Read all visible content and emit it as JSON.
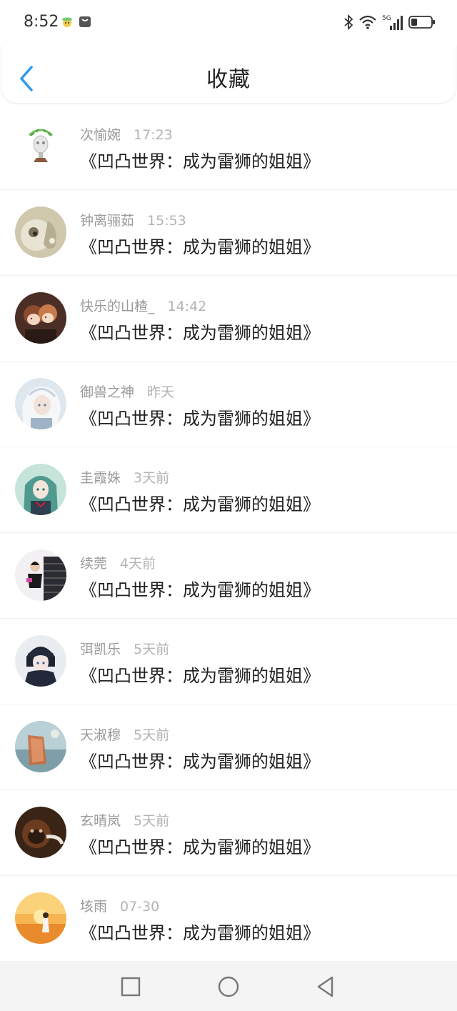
{
  "status_bar": {
    "time": "8:52",
    "icons": [
      "notification-face-icon",
      "notification-app-icon",
      "bluetooth-icon",
      "wifi-icon",
      "cellular-5g-icon",
      "battery-icon"
    ],
    "network_label": "5G",
    "battery_level": 0.3
  },
  "header": {
    "title": "收藏",
    "back_icon": "chevron-left-icon",
    "accent_color": "#2f9bf0"
  },
  "items": [
    {
      "name": "次愉婉",
      "time": "17:23",
      "message": "《凹凸世界：成为雷狮的姐姐》",
      "avatar": "trophy-figure"
    },
    {
      "name": "钟离骊茹",
      "time": "15:53",
      "message": "《凹凸世界：成为雷狮的姐姐》",
      "avatar": "animal-closeup"
    },
    {
      "name": "快乐的山楂_",
      "time": "14:42",
      "message": "《凹凸世界：成为雷狮的姐姐》",
      "avatar": "anime-duo"
    },
    {
      "name": "御兽之神",
      "time": "昨天",
      "message": "《凹凸世界：成为雷狮的姐姐》",
      "avatar": "white-haired-anime"
    },
    {
      "name": "圭霞姝",
      "time": "3天前",
      "message": "《凹凸世界：成为雷狮的姐姐》",
      "avatar": "teal-anime-girl"
    },
    {
      "name": "续莞",
      "time": "4天前",
      "message": "《凹凸世界：成为雷狮的姐姐》",
      "avatar": "woman-on-stairs"
    },
    {
      "name": "弭凯乐",
      "time": "5天前",
      "message": "《凹凸世界：成为雷狮的姐姐》",
      "avatar": "anime-boy-dark"
    },
    {
      "name": "天淑穆",
      "time": "5天前",
      "message": "《凹凸世界：成为雷狮的姐姐》",
      "avatar": "sea-glass"
    },
    {
      "name": "玄晴岚",
      "time": "5天前",
      "message": "《凹凸世界：成为雷狮的姐姐》",
      "avatar": "orangutan"
    },
    {
      "name": "垓雨",
      "time": "07-30",
      "message": "《凹凸世界：成为雷狮的姐姐》",
      "avatar": "sunset-silhouette"
    }
  ],
  "nav_bar": {
    "buttons": [
      "recents-square-icon",
      "home-circle-icon",
      "back-triangle-icon"
    ]
  }
}
